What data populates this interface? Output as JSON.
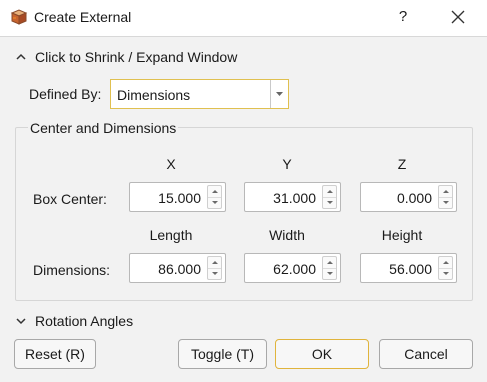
{
  "window": {
    "title": "Create External",
    "help_label": "?"
  },
  "shrink_toggle": {
    "label": "Click to Shrink / Expand Window"
  },
  "defined_by": {
    "label": "Defined By:",
    "value": "Dimensions"
  },
  "group": {
    "title": "Center and Dimensions"
  },
  "box_center": {
    "headers": [
      "X",
      "Y",
      "Z"
    ],
    "label": "Box Center:",
    "values": [
      "15.000",
      "31.000",
      "0.000"
    ]
  },
  "dimensions": {
    "headers": [
      "Length",
      "Width",
      "Height"
    ],
    "label": "Dimensions:",
    "values": [
      "86.000",
      "62.000",
      "56.000"
    ]
  },
  "rotation": {
    "label": "Rotation Angles"
  },
  "buttons": {
    "reset": "Reset (R)",
    "toggle": "Toggle (T)",
    "ok": "OK",
    "cancel": "Cancel"
  },
  "icons": {
    "app": "box-icon",
    "help": "help-icon",
    "close": "close-icon"
  }
}
